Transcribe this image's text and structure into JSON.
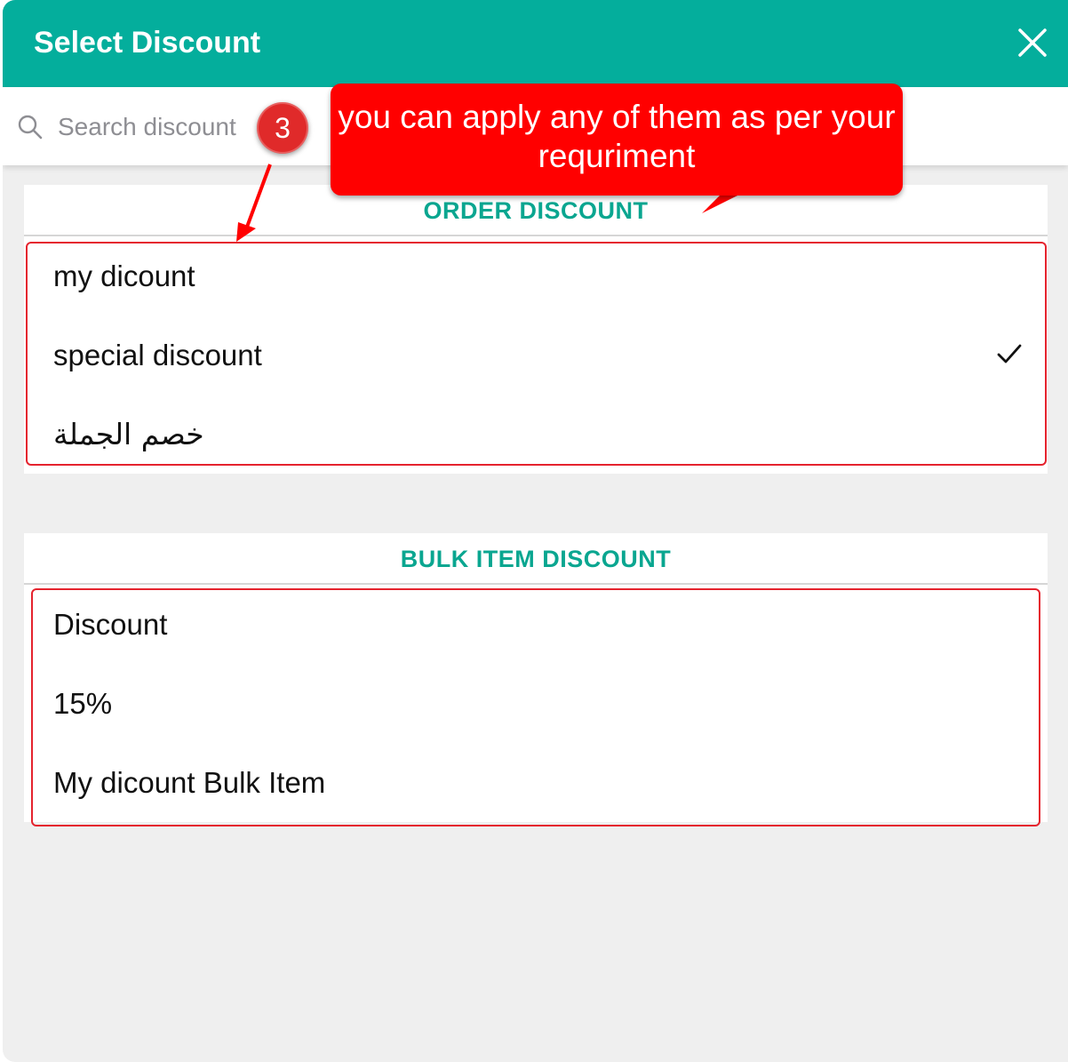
{
  "dialog": {
    "title": "Select Discount",
    "close_icon": "close-icon"
  },
  "search": {
    "placeholder": "Search discount",
    "icon": "search-icon"
  },
  "order_discount": {
    "header": "ORDER DISCOUNT",
    "items": [
      {
        "label": "my dicount",
        "selected": false
      },
      {
        "label": "special discount",
        "selected": true
      },
      {
        "label": "خصم الجملة",
        "selected": false
      }
    ]
  },
  "bulk_item_discount": {
    "header": "BULK ITEM DISCOUNT",
    "items": [
      {
        "label": "Discount"
      },
      {
        "label": "15%"
      },
      {
        "label": "My dicount Bulk Item"
      }
    ]
  },
  "annotation": {
    "callout_text": "you can apply any of them as per your requriment",
    "step_badge": "3"
  },
  "colors": {
    "header_bg": "#04ae9c",
    "section_header_text": "#0aa690",
    "annotation_red": "#ff0000"
  }
}
